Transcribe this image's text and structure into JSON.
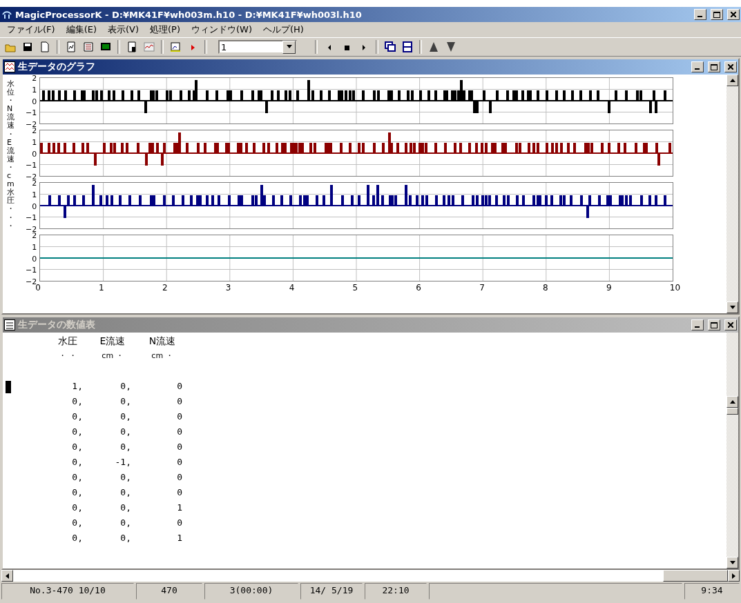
{
  "app": {
    "title": "MagicProcessorK - D:¥MK41F¥wh003m.h10 - D:¥MK41F¥wh003l.h10"
  },
  "menu": [
    "ファイル(F)",
    "編集(E)",
    "表示(V)",
    "処理(P)",
    "ウィンドウ(W)",
    "ヘルプ(H)"
  ],
  "toolbar": {
    "combo_value": "1"
  },
  "graph_window": {
    "title": "生データのグラフ",
    "active": true,
    "y_axis_label": "水位・N流速・E流速・cm水圧・・・",
    "panels": [
      {
        "color": "#000000",
        "flat": false,
        "y_ticks": [
          "2",
          "1",
          "0",
          "−1",
          "−2"
        ]
      },
      {
        "color": "#8b0000",
        "flat": false,
        "y_ticks": [
          "2",
          "1",
          "0",
          "−1",
          "−2"
        ]
      },
      {
        "color": "#000080",
        "flat": false,
        "y_ticks": [
          "2",
          "1",
          "0",
          "−1",
          "−2"
        ]
      },
      {
        "color": "#008080",
        "flat": true,
        "y_ticks": [
          "2",
          "1",
          "0",
          "−1",
          "−2"
        ]
      }
    ],
    "x_ticks": [
      "0",
      "1",
      "2",
      "3",
      "4",
      "5",
      "6",
      "7",
      "8",
      "9",
      "10"
    ]
  },
  "table_window": {
    "title": "生データの数値表",
    "active": false,
    "columns": [
      {
        "name": "水圧",
        "unit": "・ ・"
      },
      {
        "name": "E流速",
        "unit": "cm ・"
      },
      {
        "name": "N流速",
        "unit": "cm ・"
      }
    ],
    "rows": [
      [
        "1,",
        "0,",
        "0"
      ],
      [
        "0,",
        "0,",
        "0"
      ],
      [
        "0,",
        "0,",
        "0"
      ],
      [
        "0,",
        "0,",
        "0"
      ],
      [
        "0,",
        "0,",
        "0"
      ],
      [
        "0,",
        "-1,",
        "0"
      ],
      [
        "0,",
        "0,",
        "0"
      ],
      [
        "0,",
        "0,",
        "0"
      ],
      [
        "0,",
        "0,",
        "1"
      ],
      [
        "0,",
        "0,",
        "0"
      ],
      [
        "0,",
        "0,",
        "1"
      ]
    ]
  },
  "status_bar": [
    "No.3-470 10/10",
    "470",
    "3(00:00)",
    "14/ 5/19",
    "22:10",
    "9:34"
  ]
}
